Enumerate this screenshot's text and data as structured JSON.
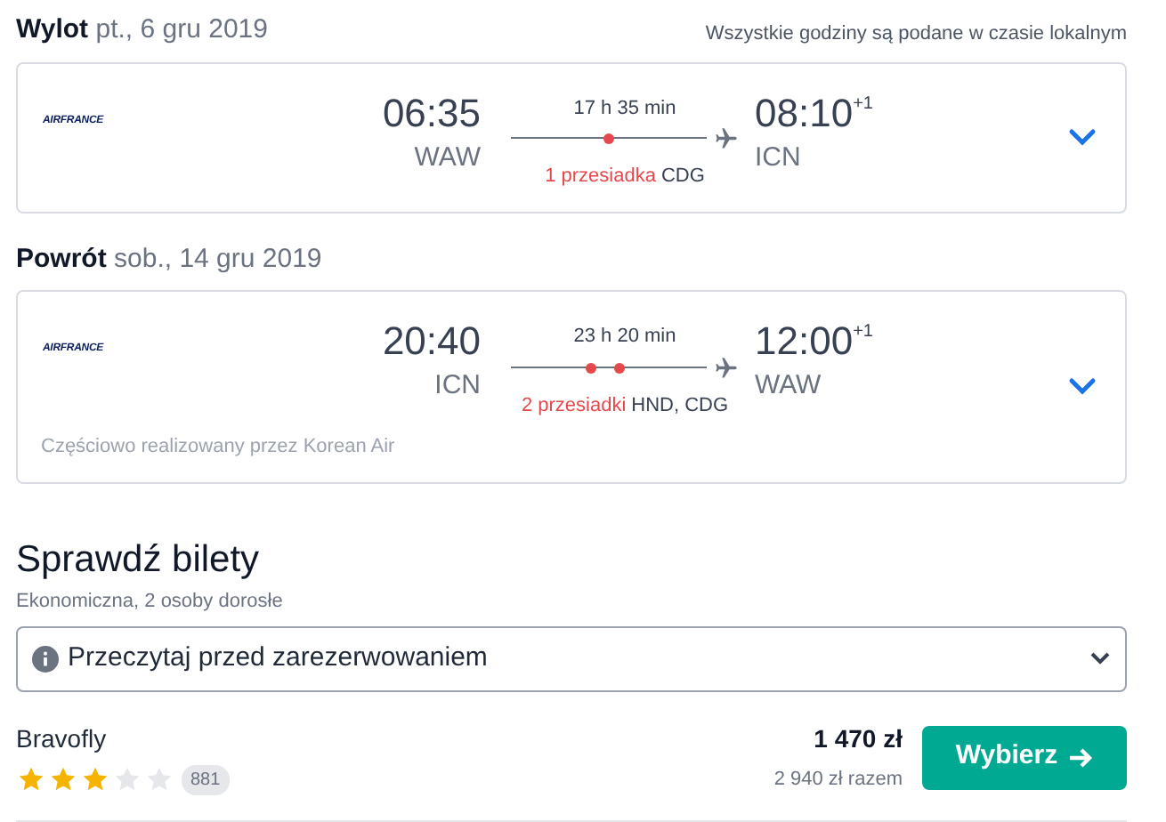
{
  "flights": [
    {
      "direction": "Wylot",
      "date": "pt., 6 gru 2019",
      "note": "Wszystkie godziny są podane w czasie lokalnym",
      "airline": "AIRFRANCE",
      "dep_time": "06:35",
      "dep_airport": "WAW",
      "duration": "17 h 35 min",
      "stops_label": "1 przesiadka",
      "stop_airports": "CDG",
      "arr_time": "08:10",
      "arr_day": "+1",
      "arr_airport": "ICN"
    },
    {
      "direction": "Powrót",
      "date": "sob., 14 gru 2019",
      "airline": "AIRFRANCE",
      "dep_time": "20:40",
      "dep_airport": "ICN",
      "duration": "23 h 20 min",
      "stops_label": "2 przesiadki",
      "stop_airports": "HND, CDG",
      "arr_time": "12:00",
      "arr_day": "+1",
      "arr_airport": "WAW",
      "operated_by": "Częściowo realizowany przez Korean Air"
    }
  ],
  "tickets": {
    "title": "Sprawdź bilety",
    "subtitle": "Ekonomiczna, 2 osoby dorosłe",
    "notice": "Przeczytaj przed zarezerwowaniem",
    "expanded": false,
    "offers": [
      {
        "provider": "Bravofly",
        "stars": 3,
        "reviews": "881",
        "price": "1 470 zł",
        "total": "2 940 zł razem",
        "button": "Wybierz"
      }
    ]
  }
}
